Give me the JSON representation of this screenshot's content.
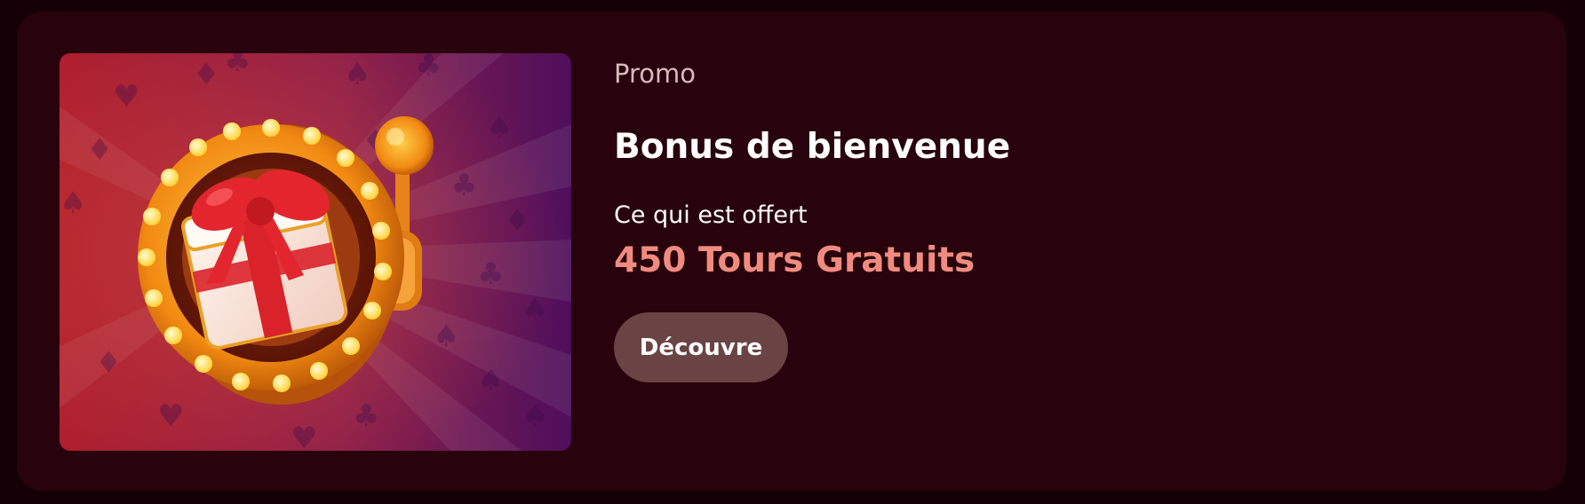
{
  "promo": {
    "eyebrow": "Promo",
    "title": "Bonus de bienvenue",
    "offer_label": "Ce qui est offert",
    "offer_value": "450 Tours Gratuits",
    "cta_label": "Découvre",
    "image_icon": "slot-machine-gift-icon"
  },
  "colors": {
    "page_background": "#140006",
    "card_background": "#28020c",
    "eyebrow": "#d9b8be",
    "title": "#ffffff",
    "offer_value": "#f08b80",
    "button_background": "#6a4444",
    "button_text": "#ffffff"
  }
}
